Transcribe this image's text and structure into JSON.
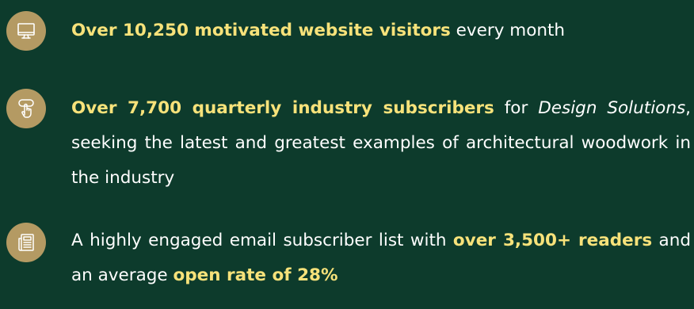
{
  "colors": {
    "background": "#0d3b2c",
    "icon_badge": "#b49a63",
    "highlight": "#f7e27a",
    "body_text": "#ffffff"
  },
  "items": [
    {
      "icon": "monitor-icon",
      "highlight": "Over 10,250 motivated website visitors",
      "text": " every month"
    },
    {
      "icon": "touch-hand-icon",
      "highlight": "Over 7,700 quarterly industry subscribers",
      "text_before_publication": " for ",
      "publication": "Design Solutions",
      "text_after_publication": ", seeking the latest and greatest examples of architectural woodwork in the industry"
    },
    {
      "icon": "newspaper-icon",
      "text_before_highlight": "A highly engaged email subscriber list with ",
      "highlight_readers": "over 3,500+ readers",
      "text_middle": " and an average ",
      "highlight_open_rate": "open rate of 28%"
    }
  ]
}
